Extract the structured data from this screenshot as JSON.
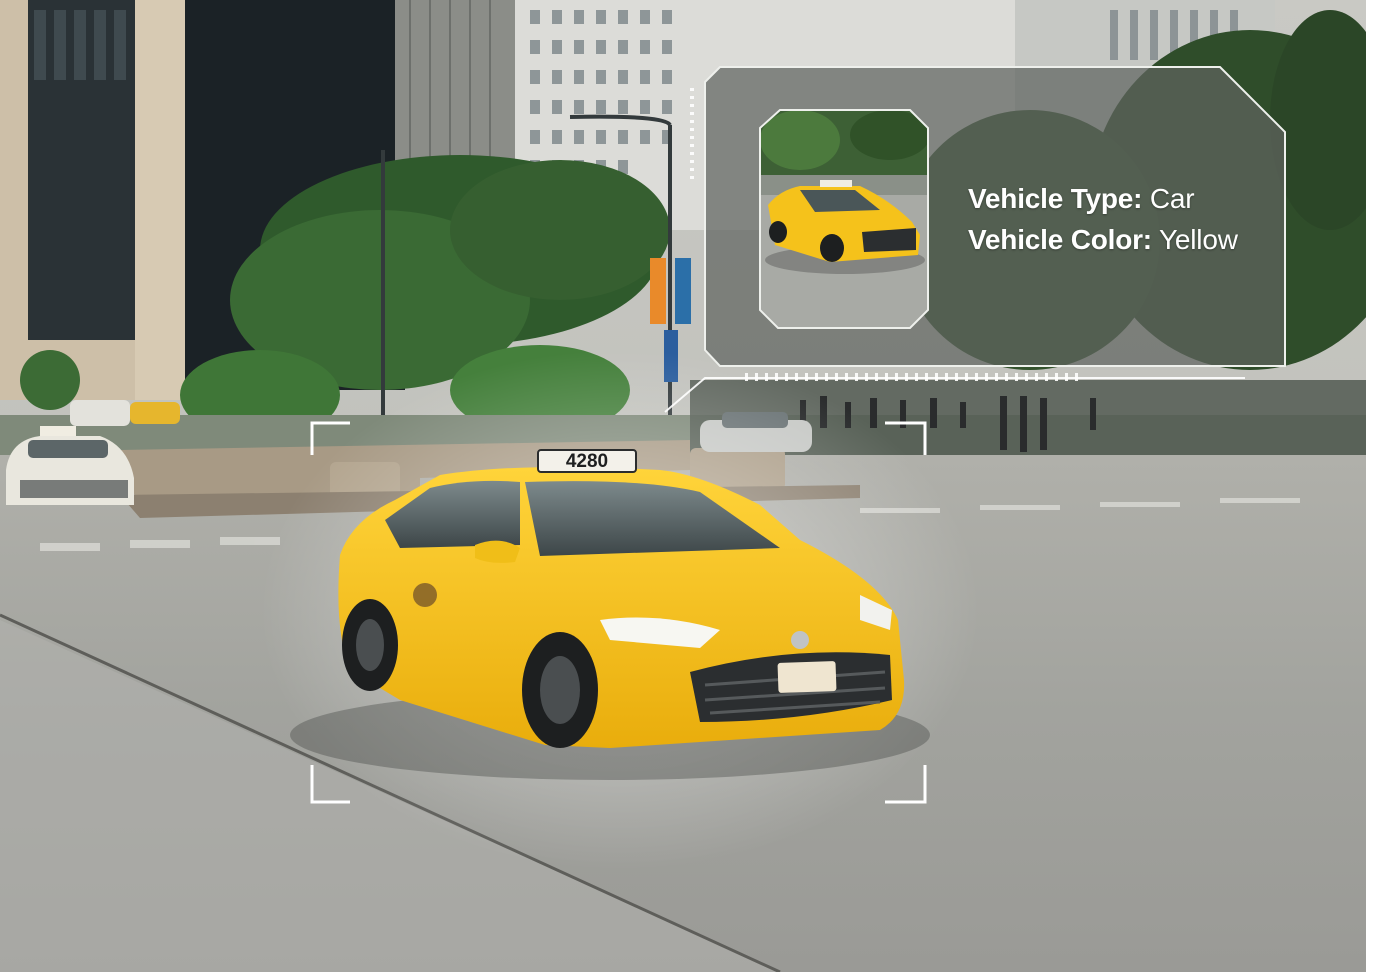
{
  "detection": {
    "type_label": "Vehicle Type:",
    "type_value": "Car",
    "color_label": "Vehicle Color:",
    "color_value": "Yellow"
  },
  "taxi": {
    "roof_number": "4280"
  },
  "colors": {
    "taxi": "#f5c21b",
    "panel_overlay": "#5f6460",
    "bracket": "#ffffff",
    "pavement": "#9fa09b"
  }
}
